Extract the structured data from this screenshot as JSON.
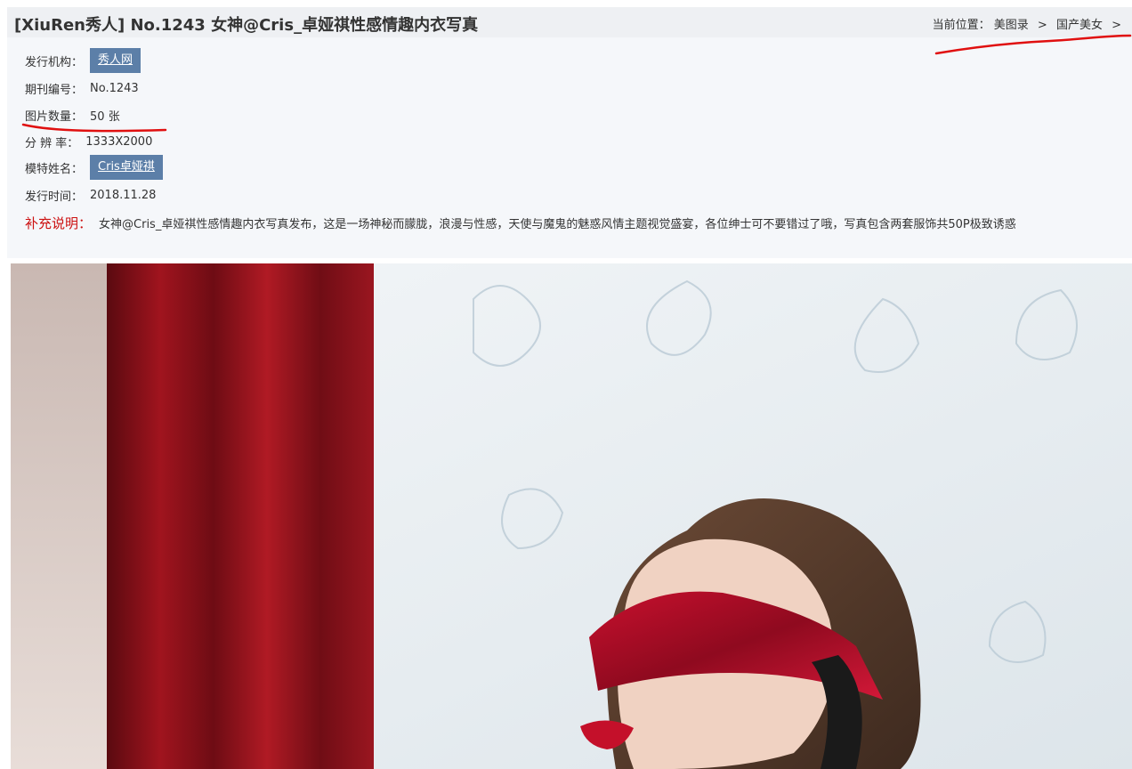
{
  "header": {
    "title": "[XiuRen秀人] No.1243 女神@Cris_卓娅祺性感情趣内衣写真",
    "breadcrumb": {
      "prefix": "当前位置：",
      "items": [
        "美图录",
        "国产美女"
      ],
      "separator": ">"
    }
  },
  "info": {
    "publisher": {
      "label": "发行机构：",
      "value": "秀人网"
    },
    "issue": {
      "label": "期刊编号：",
      "value": "No.1243"
    },
    "count": {
      "label": "图片数量：",
      "value": "50 张"
    },
    "resolution": {
      "label": "分 辨 率：",
      "value": "1333X2000"
    },
    "model": {
      "label": "模特姓名：",
      "value": "Cris卓娅祺"
    },
    "date": {
      "label": "发行时间：",
      "value": "2018.11.28"
    },
    "supplement": {
      "label": "补充说明：",
      "value": "女神@Cris_卓娅祺性感情趣内衣写真发布，这是一场神秘而朦胧，浪漫与性感，天使与魔鬼的魅惑风情主题视觉盛宴，各位绅士可不要错过了哦，写真包含两套服饰共50P极致诱惑"
    }
  },
  "colors": {
    "tag_bg": "#5c7fa8",
    "supplement_label": "#cc1111",
    "annotation_red": "#e01010"
  }
}
